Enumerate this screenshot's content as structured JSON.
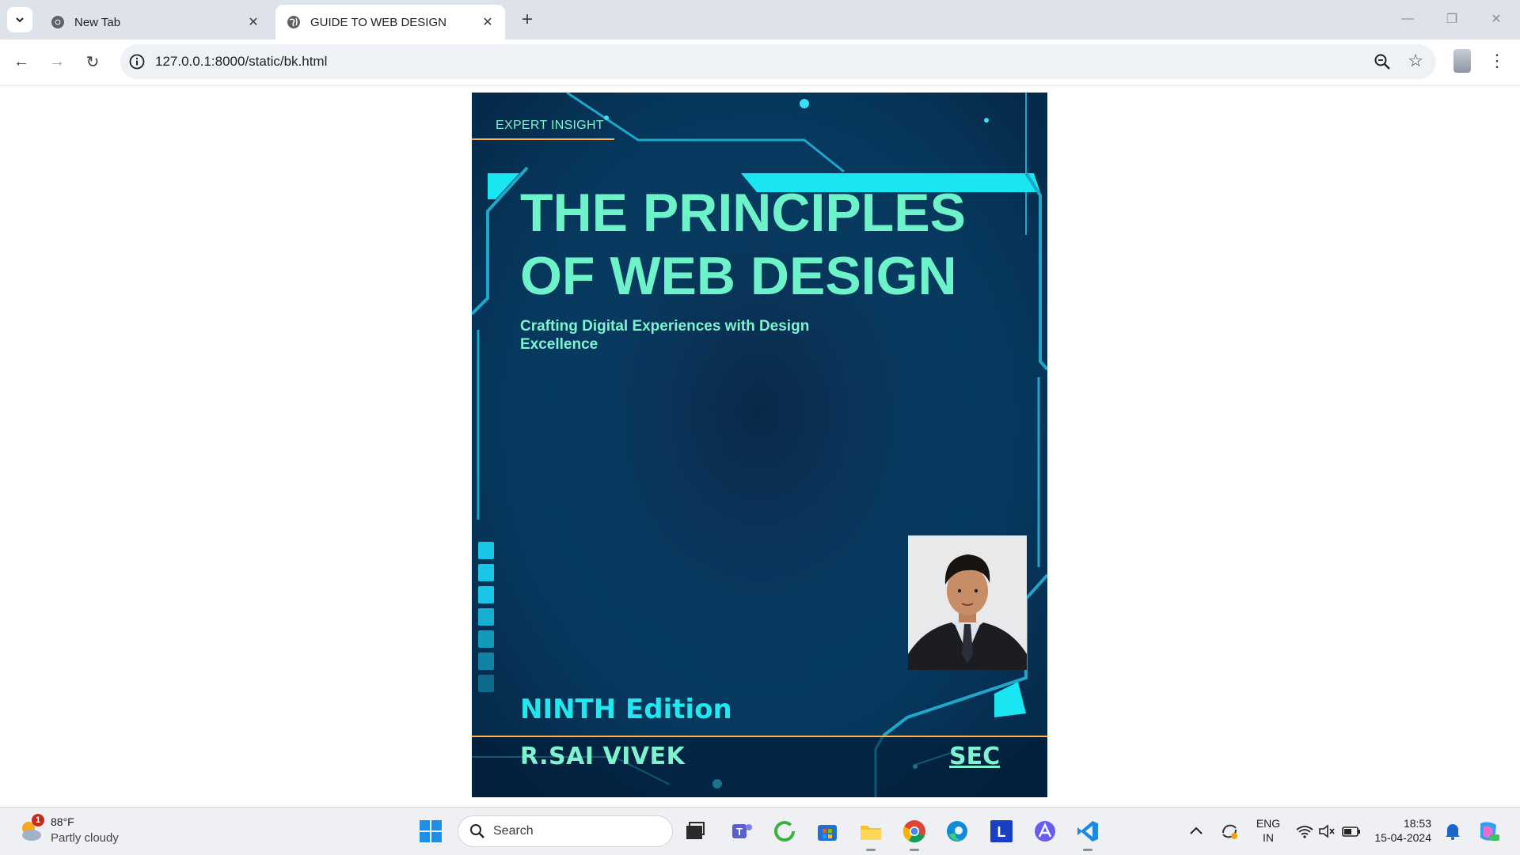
{
  "browser": {
    "tabs": [
      {
        "title": "New Tab",
        "active": false
      },
      {
        "title": "GUIDE TO WEB DESIGN",
        "active": true
      }
    ],
    "url": "127.0.0.1:8000/static/bk.html",
    "icons": [
      "chevron-down-icon",
      "chrome-icon",
      "globe-icon",
      "close-icon",
      "plus-icon",
      "minimize-icon",
      "restore-icon",
      "close-window-icon",
      "back-icon",
      "forward-icon",
      "reload-icon",
      "info-icon",
      "zoom-icon",
      "star-icon",
      "profile-icon",
      "kebab-menu-icon"
    ]
  },
  "cover": {
    "series_label": "EXPERT INSIGHT",
    "title_line1": "THE PRINCIPLES",
    "title_line2": "OF WEB DESIGN",
    "subtitle_line1": "Crafting Digital Experiences with Design",
    "subtitle_line2": "Excellence",
    "edition": "NINTH Edition",
    "author": "R.SAI VIVEK",
    "publisher": "SEC",
    "colors": {
      "accent": "#6df2c9",
      "edition": "#21e7ef",
      "rule": "#ffb347",
      "background": "#06345a"
    }
  },
  "taskbar": {
    "weather": {
      "temperature": "88°F",
      "condition": "Partly cloudy",
      "badge": "1"
    },
    "search_placeholder": "Search",
    "apps": [
      "windows-start",
      "file-explorer-dark",
      "teams",
      "green-circle-app",
      "microsoft-store",
      "file-explorer",
      "chrome",
      "edge",
      "l-app",
      "arc-app",
      "vs-code"
    ],
    "tray": {
      "lang_top": "ENG",
      "lang_bottom": "IN",
      "time": "18:53",
      "date": "15-04-2024"
    }
  }
}
